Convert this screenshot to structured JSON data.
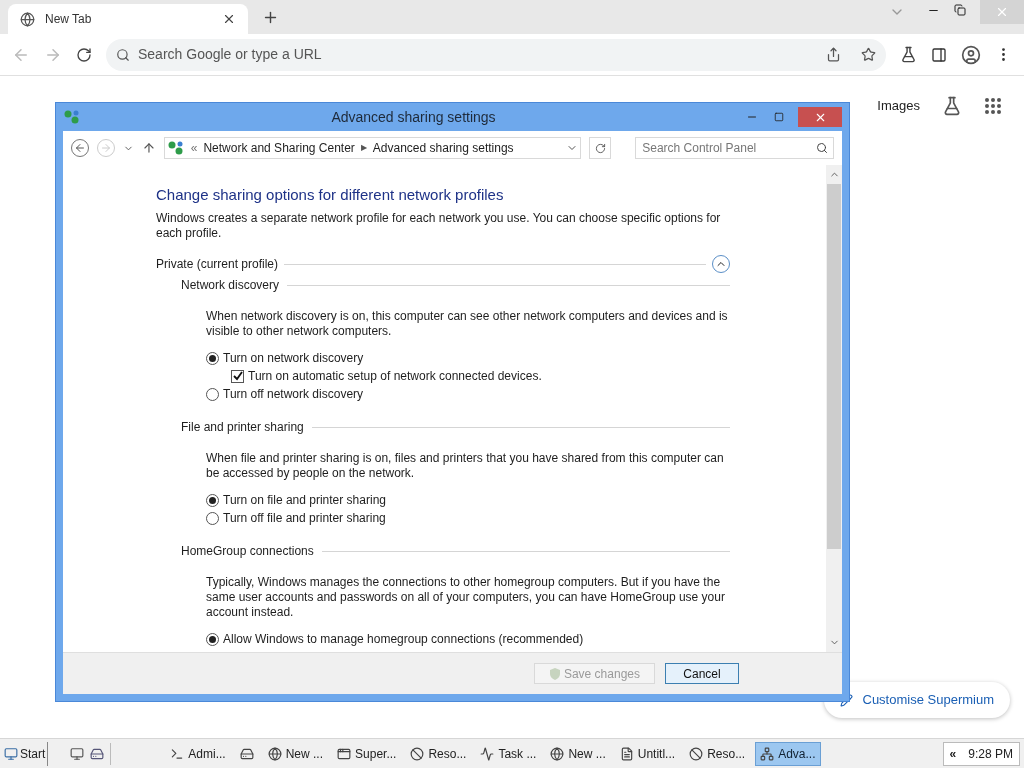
{
  "browser": {
    "tab": {
      "title": "New Tab"
    },
    "address": {
      "placeholder": "Search Google or type a URL"
    },
    "links": [
      "Images"
    ],
    "customise": "Customise Supermium"
  },
  "dialog": {
    "title": "Advanced sharing settings",
    "breadcrumb_prefix": "«",
    "breadcrumb_separator": "▶",
    "breadcrumb": [
      "Network and Sharing Center",
      "Advanced sharing settings"
    ],
    "search": {
      "placeholder": "Search Control Panel"
    },
    "heading": "Change sharing options for different network profiles",
    "intro": "Windows creates a separate network profile for each network you use. You can choose specific options for each profile.",
    "profile": {
      "label": "Private (current profile)",
      "expanded": true
    },
    "sections": [
      {
        "title": "Network discovery",
        "description": "When network discovery is on, this computer can see other network computers and devices and is visible to other network computers.",
        "options": [
          {
            "kind": "radio",
            "label": "Turn on network discovery",
            "selected": true
          },
          {
            "kind": "checkbox",
            "label": "Turn on automatic setup of network connected devices.",
            "checked": true
          },
          {
            "kind": "radio",
            "label": "Turn off network discovery",
            "selected": false
          }
        ]
      },
      {
        "title": "File and printer sharing",
        "description": "When file and printer sharing is on, files and printers that you have shared from this computer can be accessed by people on the network.",
        "options": [
          {
            "kind": "radio",
            "label": "Turn on file and printer sharing",
            "selected": true
          },
          {
            "kind": "radio",
            "label": "Turn off file and printer sharing",
            "selected": false
          }
        ]
      },
      {
        "title": "HomeGroup connections",
        "description": "Typically, Windows manages the connections to other homegroup computers. But if you have the same user accounts and passwords on all of your computers, you can have HomeGroup use your account instead.",
        "options": [
          {
            "kind": "radio",
            "label": "Allow Windows to manage homegroup connections (recommended)",
            "selected": true
          }
        ]
      }
    ],
    "buttons": [
      {
        "label": "Save changes",
        "disabled": true
      },
      {
        "label": "Cancel",
        "disabled": false
      }
    ]
  },
  "taskbar": {
    "start": "Start",
    "items": [
      {
        "kind": "terminal",
        "label": "Admi...",
        "active": false
      },
      {
        "kind": "disk",
        "active": false
      },
      {
        "kind": "ie",
        "label": "New ...",
        "active": false
      },
      {
        "kind": "window",
        "label": "Super...",
        "active": false
      },
      {
        "kind": "blocked",
        "label": "Reso...",
        "active": false
      },
      {
        "kind": "chart",
        "label": "Task ...",
        "active": false
      },
      {
        "kind": "globe",
        "label": "New ...",
        "active": false
      },
      {
        "kind": "notepad",
        "label": "Untitl...",
        "active": false
      },
      {
        "kind": "blocked",
        "label": "Reso...",
        "active": false
      },
      {
        "kind": "network",
        "label": "Adva...",
        "active": true
      }
    ],
    "tray_toggle": "«",
    "clock": "9:28 PM"
  }
}
